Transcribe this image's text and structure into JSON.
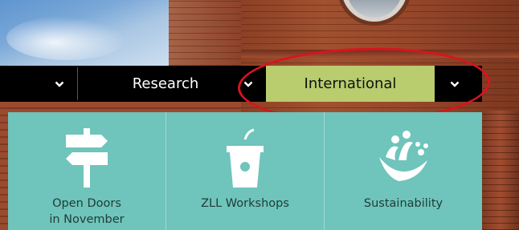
{
  "nav": {
    "items": [
      {
        "label": "Research"
      },
      {
        "label": "International",
        "active": true
      }
    ],
    "active_color": "#b9cc6e",
    "bar_color": "#000000"
  },
  "annotation": {
    "type": "red-ellipse",
    "color": "#d8141f",
    "target": "International"
  },
  "panel": {
    "background": "#6fc4bb",
    "tiles": [
      {
        "icon": "signpost-icon",
        "label_line1": "Open Doors",
        "label_line2": "in November"
      },
      {
        "icon": "lectern-icon",
        "label_line1": "ZLL Workshops",
        "label_line2": ""
      },
      {
        "icon": "sustainability-icon",
        "label_line1": "Sustainability",
        "label_line2": ""
      }
    ]
  }
}
